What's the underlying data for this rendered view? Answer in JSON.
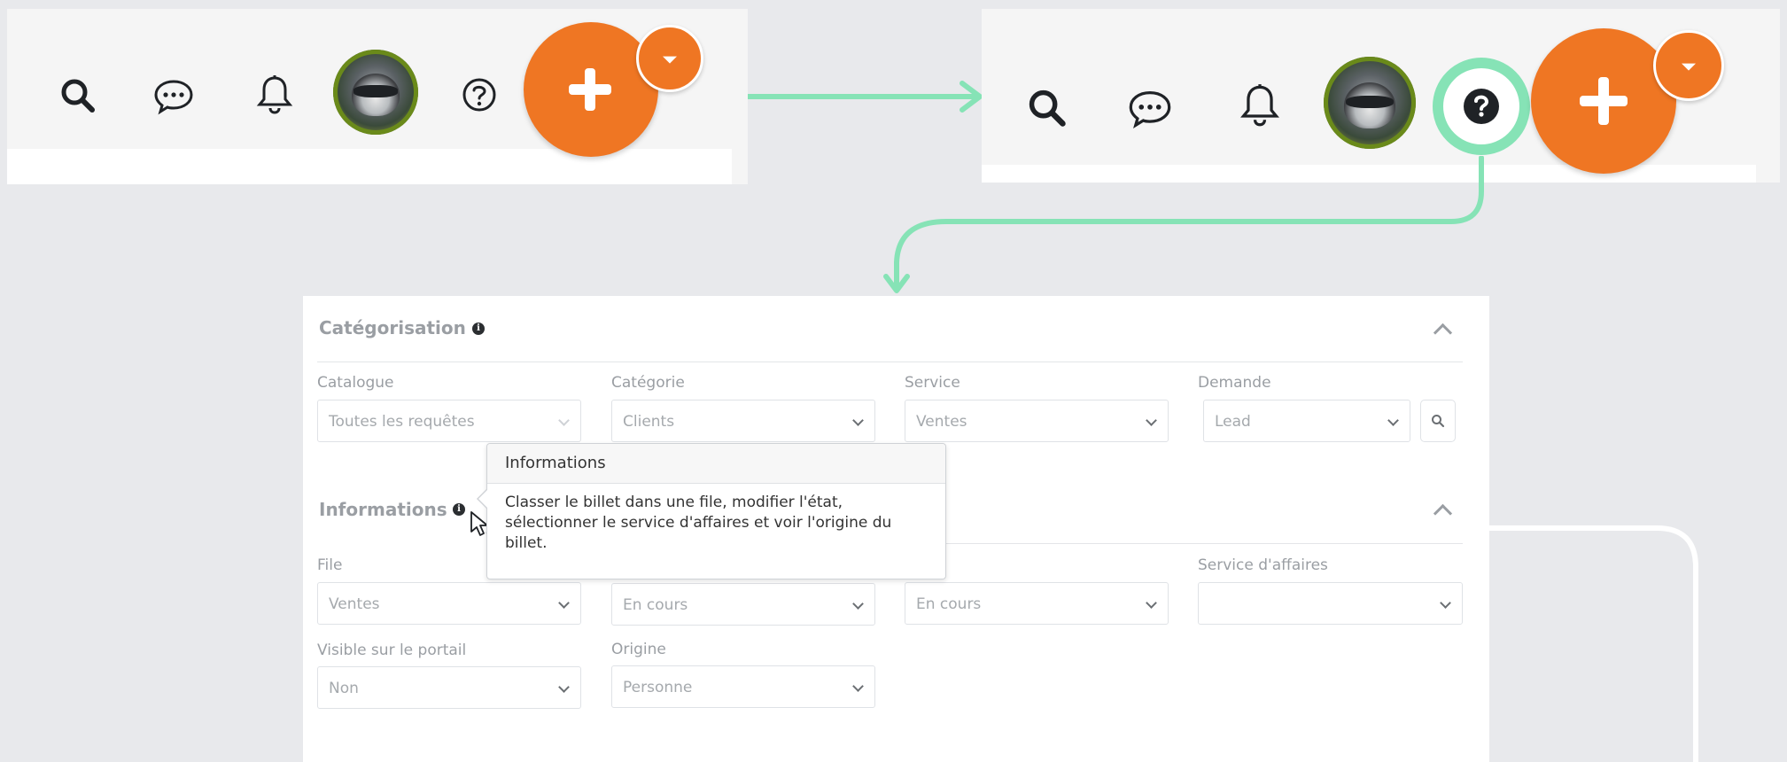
{
  "colors": {
    "accent": "#ef7623",
    "highlight": "#86e3b6",
    "canvas": "#e8e9ec"
  },
  "header_before": {
    "icons": [
      "search-icon",
      "chat-icon",
      "bell-icon",
      "avatar",
      "help-icon"
    ],
    "fab_icon": "plus-icon",
    "fab_menu_icon": "caret-down-icon"
  },
  "header_after": {
    "icons": [
      "search-icon",
      "chat-icon",
      "bell-icon",
      "avatar",
      "help-icon"
    ],
    "highlighted_icon": "help-icon",
    "fab_icon": "plus-icon",
    "fab_menu_icon": "caret-down-icon"
  },
  "form": {
    "categorisation": {
      "title": "Catégorisation",
      "fields": [
        {
          "label": "Catalogue",
          "value": "Toutes les requêtes"
        },
        {
          "label": "Catégorie",
          "value": "Clients"
        },
        {
          "label": "Service",
          "value": "Ventes"
        },
        {
          "label": "Demande",
          "value": "Lead"
        }
      ]
    },
    "informations": {
      "title": "Informations",
      "fields_row1": [
        {
          "label": "File",
          "value": "Ventes"
        },
        {
          "label": "",
          "value": "En cours"
        },
        {
          "label": "",
          "value": "En cours"
        },
        {
          "label": "Service d'affaires",
          "value": ""
        }
      ],
      "fields_row2": [
        {
          "label": "Visible sur le portail",
          "value": "Non"
        },
        {
          "label": "Origine",
          "value": "Personne"
        }
      ]
    }
  },
  "tooltip": {
    "title": "Informations",
    "body": "Classer le billet dans une file, modifier l'état, sélectionner le service d'affaires et voir l'origine du billet."
  }
}
